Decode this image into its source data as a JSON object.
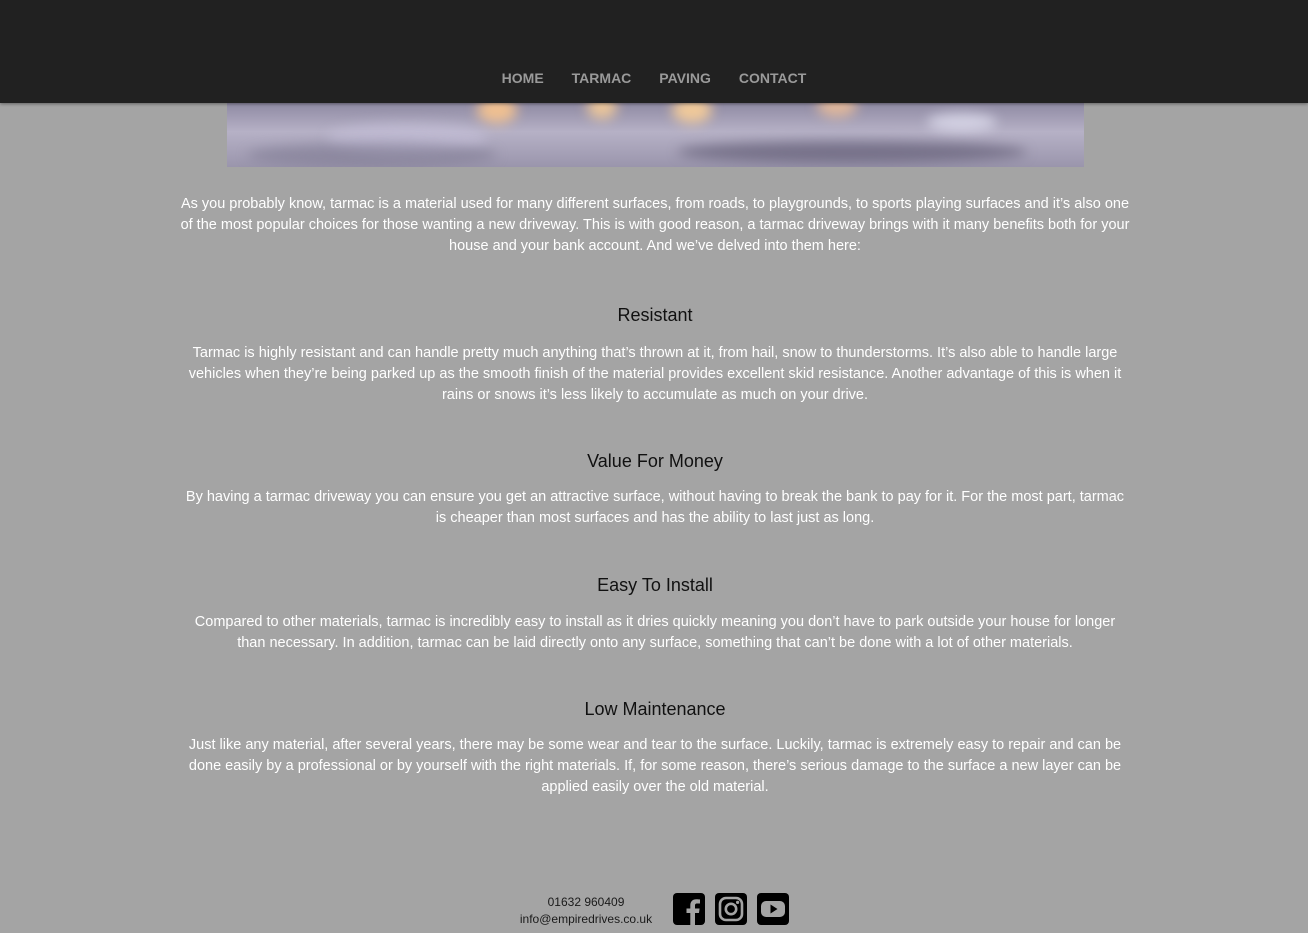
{
  "nav": {
    "items": [
      "HOME",
      "TARMAC",
      "PAVING",
      "CONTACT"
    ]
  },
  "main": {
    "intro": "As you probably know, tarmac is a material used for many different surfaces, from roads, to playgrounds, to sports playing surfaces and it’s also one of the most popular choices for those wanting a new driveway. This is with good reason, a tarmac driveway brings with it many benefits both for your house and your bank account. And we’ve delved into them here:",
    "sections": [
      {
        "title": "Resistant",
        "text": "Tarmac is highly resistant and can handle pretty much anything that’s thrown at it, from hail, snow to thunderstorms. It’s also able to handle large vehicles when they’re being parked up as the smooth finish of the material provides excellent skid resistance. Another advantage of this is when it rains or snows it’s less likely to accumulate as much on your drive."
      },
      {
        "title": "Value For Money",
        "text": "By having a tarmac driveway you can ensure you get an attractive surface, without having to break the bank to pay for it. For the most part, tarmac is cheaper than most surfaces and has the ability to last just as long."
      },
      {
        "title": "Easy To Install",
        "text": "Compared to other materials, tarmac is incredibly easy to install as it dries quickly meaning you don’t have to park outside your house for longer than necessary. In addition, tarmac can be laid directly onto any surface, something that can’t be done with a lot of other materials."
      },
      {
        "title": "Low Maintenance",
        "text": "Just like any material, after several years, there may be some wear and tear to the surface. Luckily, tarmac is extremely easy to repair and can be done easily by a professional or by yourself with the right materials. If, for some reason, there’s serious damage to the surface a new layer can be applied easily over the old material."
      }
    ]
  },
  "footer": {
    "phone": "01632 960409",
    "email": "info@empiredrives.co.uk",
    "social": [
      "facebook-icon",
      "instagram-icon",
      "youtube-icon"
    ]
  },
  "colors": {
    "header_bg": "#212121",
    "page_bg": "#a4a4a4",
    "nav_text": "#9a9a9a",
    "body_text": "#ffffff",
    "heading_text": "#111111"
  }
}
